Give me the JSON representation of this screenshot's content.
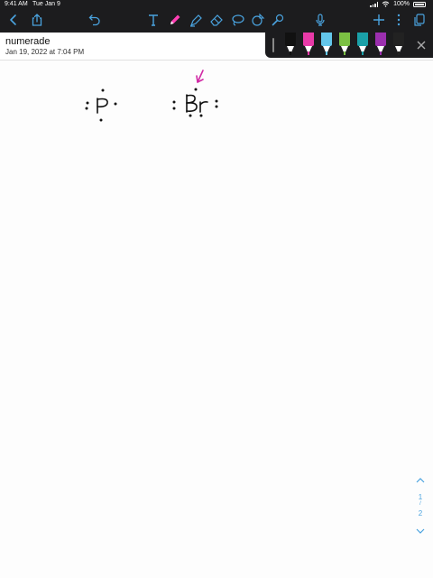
{
  "status_bar": {
    "time": "9:41 AM",
    "date": "Tue Jan 9",
    "battery": "100%"
  },
  "toolbar": {
    "left_icons": [
      "back-chevron-icon",
      "share-icon",
      "undo-icon"
    ],
    "tool_icons": [
      "text-tool-icon",
      "pen-tool-icon",
      "highlighter-tool-icon",
      "eraser-tool-icon",
      "lasso-tool-icon",
      "shapes-tool-icon",
      "elements-tool-icon"
    ],
    "right_icons": [
      "microphone-icon",
      "add-icon",
      "more-icon",
      "pages-icon"
    ],
    "active_tool_color": "#ff3fb4"
  },
  "note": {
    "title": "numerade",
    "date": "Jan 19, 2022 at 7:04 PM"
  },
  "pen_palette": {
    "pens": [
      {
        "color": "#111111"
      },
      {
        "color": "#e83aa8"
      },
      {
        "color": "#63c6ea"
      },
      {
        "color": "#7bc043"
      },
      {
        "color": "#1aa0a8"
      },
      {
        "color": "#9b2fae"
      },
      {
        "color": "#222222"
      }
    ]
  },
  "canvas": {
    "symbols": [
      "P",
      "Br"
    ],
    "ink_color": "#111111",
    "arrow_color": "#d12aa5"
  },
  "page_indicator": {
    "current": "1",
    "separator": "/",
    "total": "2"
  }
}
